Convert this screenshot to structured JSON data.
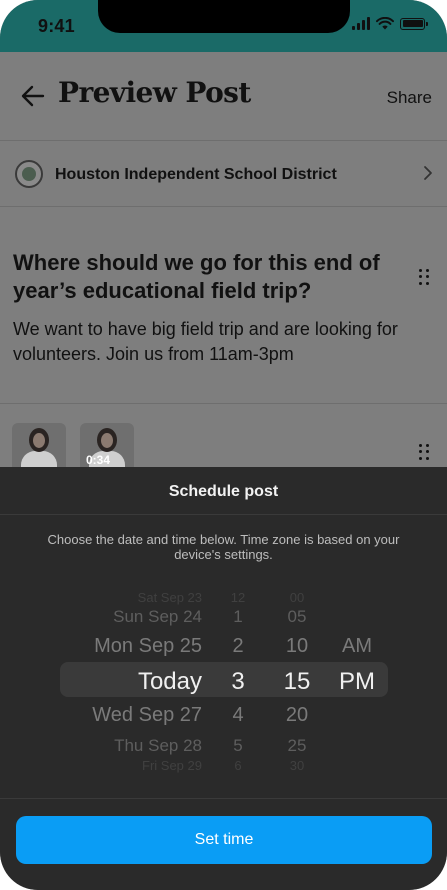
{
  "status_bar": {
    "time": "9:41"
  },
  "header": {
    "title": "Preview Post",
    "share_label": "Share"
  },
  "organization": {
    "name": "Houston Independent School District"
  },
  "post": {
    "title": "Where should we go for this end of year’s educational field trip?",
    "body": "We want to have big field trip and are looking for volunteers. Join us from 11am-3pm"
  },
  "media": {
    "video_duration": "0:34"
  },
  "sheet": {
    "title": "Schedule post",
    "description": "Choose the date and time below. Time zone is based on your device's settings.",
    "set_time_label": "Set time"
  },
  "picker": {
    "dates": [
      "Sat Sep 23",
      "Sun Sep 24",
      "Mon Sep 25",
      "Today",
      "Wed Sep 27",
      "Thu Sep 28",
      "Fri Sep 29"
    ],
    "hours": [
      "12",
      "1",
      "2",
      "3",
      "4",
      "5",
      "6"
    ],
    "minutes": [
      "00",
      "05",
      "10",
      "15",
      "20",
      "25",
      "30"
    ],
    "periods": [
      "AM",
      "PM"
    ],
    "selected": {
      "date": "Today",
      "hour": "3",
      "minute": "15",
      "period": "PM"
    }
  },
  "colors": {
    "accent": "#0a9df5",
    "status_bar": "#1a6a67",
    "sheet_bg": "#2a2a2a"
  }
}
